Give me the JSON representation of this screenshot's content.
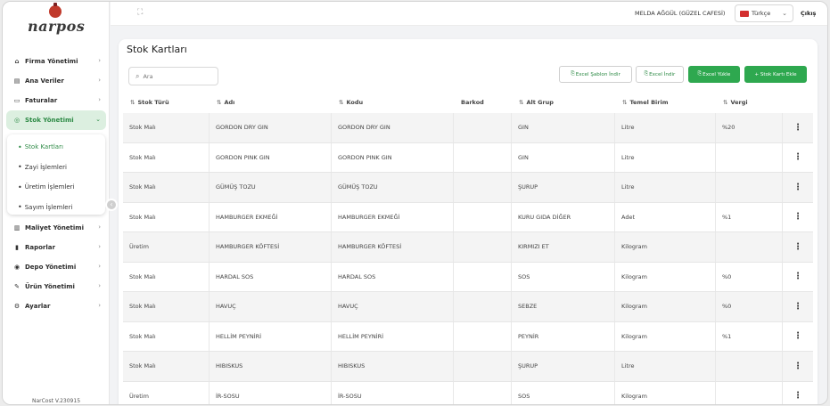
{
  "brand": {
    "logo_text": "narpos"
  },
  "sidebar": {
    "items": [
      {
        "label": "Firma Yönetimi",
        "icon": "home-icon"
      },
      {
        "label": "Ana Veriler",
        "icon": "database-icon"
      },
      {
        "label": "Faturalar",
        "icon": "invoice-icon"
      },
      {
        "label": "Stok Yönetimi",
        "icon": "stock-icon",
        "active": true
      }
    ],
    "stock_submenu": [
      {
        "label": "Stok Kartları",
        "active": true
      },
      {
        "label": "Zayi İşlemleri"
      },
      {
        "label": "Üretim İşlemleri"
      },
      {
        "label": "Sayım İşlemleri"
      }
    ],
    "items_after": [
      {
        "label": "Maliyet Yönetimi",
        "icon": "cost-icon"
      },
      {
        "label": "Raporlar",
        "icon": "report-icon"
      },
      {
        "label": "Depo Yönetimi",
        "icon": "warehouse-icon"
      },
      {
        "label": "Ürün Yönetimi",
        "icon": "product-icon"
      },
      {
        "label": "Ayarlar",
        "icon": "settings-icon"
      }
    ],
    "version": "NarCost V.230915"
  },
  "header": {
    "user": "MELDA AĞGÜL (GÜZEL CAFESİ)",
    "language": "Türkçe",
    "logout": "Çıkış"
  },
  "page": {
    "title": "Stok Kartları",
    "search_placeholder": "Ara",
    "buttons": {
      "template": "Excel Şablon İndir",
      "download": "Excel İndir",
      "upload": "Excel Yükle",
      "add": "+ Stok Kartı Ekle"
    }
  },
  "table": {
    "columns": [
      "Stok Türü",
      "Adı",
      "Kodu",
      "Barkod",
      "Alt Grup",
      "Temel Birim",
      "Vergi"
    ],
    "rows": [
      {
        "type": "Stok Malı",
        "name": "GORDON DRY GIN",
        "code": "GORDON DRY GIN",
        "barcode": "",
        "group": "GIN",
        "unit": "Litre",
        "tax": "%20"
      },
      {
        "type": "Stok Malı",
        "name": "GORDON PINK GIN",
        "code": "GORDON PINK GIN",
        "barcode": "",
        "group": "GIN",
        "unit": "Litre",
        "tax": ""
      },
      {
        "type": "Stok Malı",
        "name": "GÜMÜŞ TOZU",
        "code": "GÜMÜŞ TOZU",
        "barcode": "",
        "group": "ŞURUP",
        "unit": "Litre",
        "tax": ""
      },
      {
        "type": "Stok Malı",
        "name": "HAMBURGER EKMEĞİ",
        "code": "HAMBURGER EKMEĞİ",
        "barcode": "",
        "group": "KURU GIDA DİĞER",
        "unit": "Adet",
        "tax": "%1"
      },
      {
        "type": "Üretim",
        "name": "HAMBURGER KÖFTESİ",
        "code": "HAMBURGER KÖFTESİ",
        "barcode": "",
        "group": "KIRMIZI ET",
        "unit": "Kilogram",
        "tax": ""
      },
      {
        "type": "Stok Malı",
        "name": "HARDAL SOS",
        "code": "HARDAL SOS",
        "barcode": "",
        "group": "SOS",
        "unit": "Kilogram",
        "tax": "%0"
      },
      {
        "type": "Stok Malı",
        "name": "HAVUÇ",
        "code": "HAVUÇ",
        "barcode": "",
        "group": "SEBZE",
        "unit": "Kilogram",
        "tax": "%0"
      },
      {
        "type": "Stok Malı",
        "name": "HELLİM PEYNİRİ",
        "code": "HELLİM PEYNİRİ",
        "barcode": "",
        "group": "PEYNİR",
        "unit": "Kilogram",
        "tax": "%1"
      },
      {
        "type": "Stok Malı",
        "name": "HIBISKUS",
        "code": "HIBISKUS",
        "barcode": "",
        "group": "ŞURUP",
        "unit": "Litre",
        "tax": ""
      },
      {
        "type": "Üretim",
        "name": "İR-SOSU",
        "code": "İR-SOSU",
        "barcode": "",
        "group": "SOS",
        "unit": "Kilogram",
        "tax": ""
      }
    ]
  },
  "colors": {
    "accent": "#2ea84f",
    "active_bg": "#dcefe0",
    "brand_red": "#c0392b"
  }
}
